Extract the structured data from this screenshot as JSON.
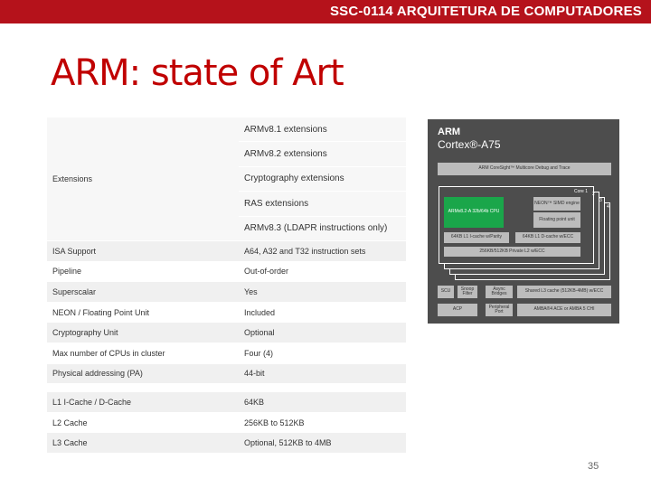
{
  "header": {
    "course_title": "SSC-0114 ARQUITETURA DE COMPUTADORES"
  },
  "slide": {
    "title": "ARM: state of Art",
    "page_number": "35"
  },
  "spec_table": {
    "extensions_label": "Extensions",
    "extensions": [
      "ARMv8.1 extensions",
      "ARMv8.2 extensions",
      "Cryptography extensions",
      "RAS extensions",
      "ARMv8.3 (LDAPR instructions only)"
    ],
    "rows": [
      {
        "label": "ISA Support",
        "value": "A64, A32 and T32 instruction sets"
      },
      {
        "label": "Pipeline",
        "value": "Out-of-order"
      },
      {
        "label": "Superscalar",
        "value": "Yes"
      },
      {
        "label": "NEON / Floating Point Unit",
        "value": "Included"
      },
      {
        "label": "Cryptography Unit",
        "value": "Optional"
      },
      {
        "label": "Max number of CPUs in cluster",
        "value": "Four (4)"
      },
      {
        "label": "Physical addressing (PA)",
        "value": "44-bit"
      }
    ],
    "cache_rows": [
      {
        "label": "L1 I-Cache / D-Cache",
        "value": "64KB"
      },
      {
        "label": "L2 Cache",
        "value": "256KB to 512KB"
      },
      {
        "label": "L3 Cache",
        "value": "Optional, 512KB to 4MB"
      }
    ]
  },
  "diagram": {
    "brand": "ARM",
    "product": "Cortex®-A75",
    "debug_trace": "ARM CoreSight™ Multicore Debug and Trace",
    "core_label": "Core 1",
    "core_numbers": [
      "2",
      "3",
      "4"
    ],
    "cpu": "ARMv8.2-A 32b/64b CPU",
    "neon": "NEON™ SIMD engine",
    "fp": "Floating point unit",
    "l1_icache": "64KB L1 I-cache w/Parity",
    "l1_dcache": "64KB L1 D-cache w/ECC",
    "l2": "256KB/512KB Private L2 w/ECC",
    "scu": "SCU",
    "snoop": "Snoop Filter",
    "async": "Async Bridges",
    "l3": "Shared L3 cache (512KB-4MB) w/ECC",
    "acp": "ACP",
    "peripheral": "Peripheral Port",
    "amba": "AMBA®4 ACE or AMBA 5 CHI"
  }
}
